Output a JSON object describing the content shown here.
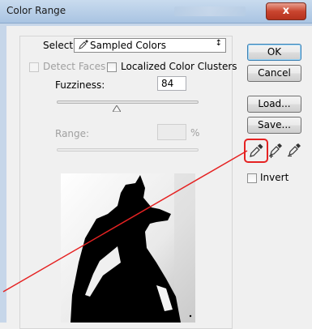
{
  "window": {
    "title": "Color Range",
    "close_label": "x"
  },
  "select": {
    "label": "Select:",
    "value": "Sampled Colors",
    "arrows": "↕"
  },
  "options": {
    "detect_faces": {
      "label": "Detect Faces",
      "checked": false,
      "enabled": false
    },
    "localized": {
      "label": "Localized Color Clusters",
      "checked": false,
      "enabled": true
    }
  },
  "fuzziness": {
    "label": "Fuzziness:",
    "value": "84",
    "slider_fraction": 0.42
  },
  "range": {
    "label": "Range:",
    "value": "",
    "unit": "%",
    "enabled": false
  },
  "buttons": {
    "ok": "OK",
    "cancel": "Cancel",
    "load": "Load...",
    "save": "Save..."
  },
  "tools": {
    "sampler": "eyedropper-icon",
    "add": "eyedropper-plus-icon",
    "subtract": "eyedropper-minus-icon",
    "active": "sampler"
  },
  "invert": {
    "label": "Invert",
    "checked": false
  },
  "annotation_color": "#e52222"
}
